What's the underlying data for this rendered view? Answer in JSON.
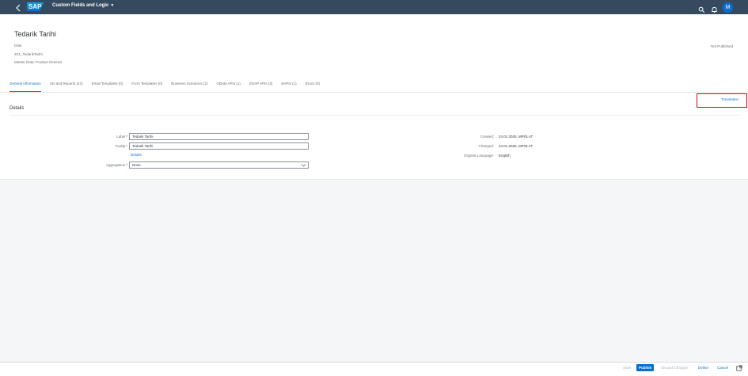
{
  "shell": {
    "logo": "SAP",
    "app_title": "Custom Fields and Logic",
    "icons": [
      "back-icon",
      "search-icon",
      "bell-icon"
    ],
    "avatar_initial": "M",
    "colors": {
      "shell_bg": "#354a5f",
      "accent": "#0a6ed1"
    }
  },
  "header": {
    "title": "Tedarik Tarihi",
    "type": "Date",
    "identifier": "ZZ1_TedarikTarihi",
    "business_context": "Master Data: Product General",
    "status": "Not Published"
  },
  "tabs": [
    {
      "label": "General Information",
      "active": true
    },
    {
      "label": "UIs and Reports (42)"
    },
    {
      "label": "Email Templates (0)"
    },
    {
      "label": "Form Templates (0)"
    },
    {
      "label": "Business Scenarios (2)"
    },
    {
      "label": "OData APIs (1)"
    },
    {
      "label": "SOAP APIs (3)"
    },
    {
      "label": "BAPIs (1)"
    },
    {
      "label": "IDocs (0)"
    }
  ],
  "translation_link": "Translation",
  "details": {
    "section_title": "Details",
    "label_field": {
      "label": "Label",
      "value": "Tedarik Tarihi"
    },
    "tooltip_field": {
      "label": "Tooltip",
      "value": "Tedarik Tarihi"
    },
    "details_link": "Details",
    "aggregation_field": {
      "label": "Aggregation",
      "value": "None"
    },
    "required_marker": "*",
    "created": {
      "label": "Created:",
      "value": "24.01.2025, MPOLAT"
    },
    "changed": {
      "label": "Changed:",
      "value": "24.01.2025, MPOLAT"
    },
    "original_language": {
      "label": "Original Language:",
      "value": "English"
    }
  },
  "footer": {
    "save": "Save",
    "publish": "Publish",
    "discard": "Discard Changes",
    "delete": "Delete",
    "cancel": "Cancel",
    "icon": "open-in-new-window-icon"
  }
}
